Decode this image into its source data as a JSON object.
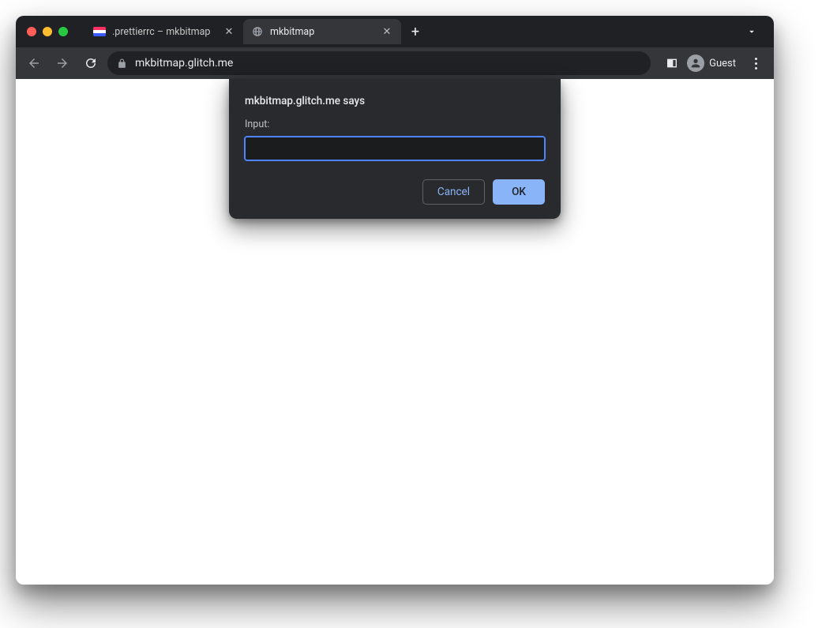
{
  "tabs": [
    {
      "title": ".prettierrc – mkbitmap",
      "active": false,
      "favicon": "glitch"
    },
    {
      "title": "mkbitmap",
      "active": true,
      "favicon": "globe"
    }
  ],
  "newtab_label": "+",
  "toolbar": {
    "url": "mkbitmap.glitch.me",
    "guest_label": "Guest"
  },
  "dialog": {
    "title": "mkbitmap.glitch.me says",
    "label": "Input:",
    "input_value": "",
    "cancel_label": "Cancel",
    "ok_label": "OK"
  }
}
